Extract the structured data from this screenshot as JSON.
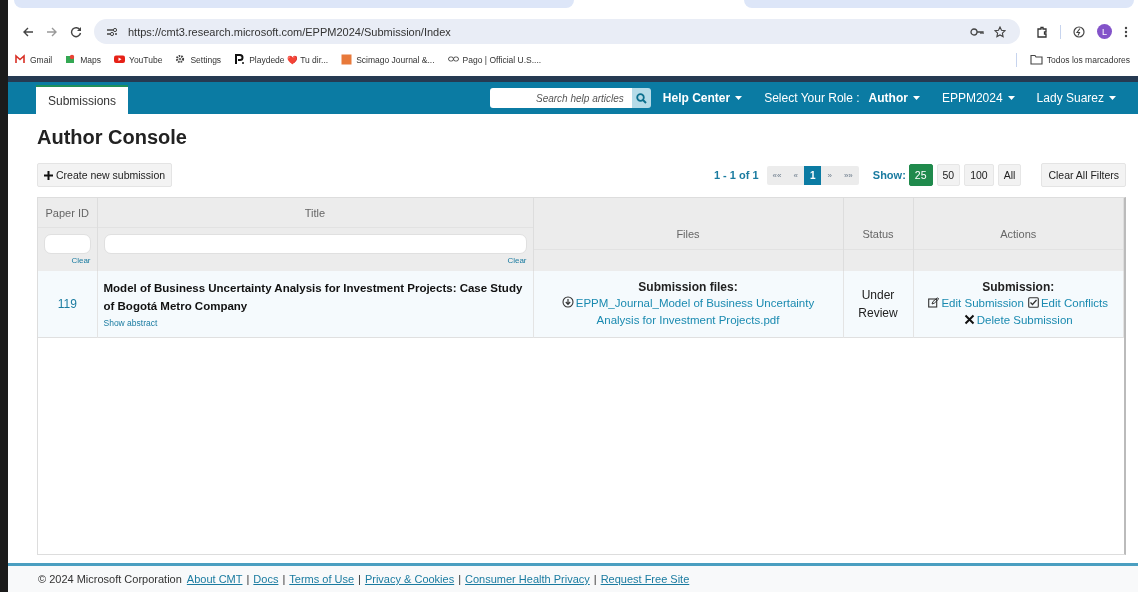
{
  "browser": {
    "url": "https://cmt3.research.microsoft.com/EPPM2024/Submission/Index",
    "profile_initial": "L",
    "bookmarks": [
      {
        "label": "Gmail",
        "kind": "mail"
      },
      {
        "label": "Maps",
        "kind": "map"
      },
      {
        "label": "YouTube",
        "kind": "video"
      },
      {
        "label": "Settings",
        "kind": "gear"
      },
      {
        "label": "Playdede ❤️ Tu dir...",
        "kind": "letter"
      },
      {
        "label": "Scimago Journal &...",
        "kind": "square"
      },
      {
        "label": "Pago | Official U.S....",
        "kind": "link"
      }
    ],
    "all_bookmarks": "Todos los marcadores"
  },
  "nav": {
    "tabs": [
      {
        "label": "Submissions",
        "selected": true
      }
    ],
    "search": {
      "placeholder": "Search help articles"
    },
    "menus": [
      {
        "label": "Help Center",
        "kind": "dropdown",
        "bold": true
      },
      {
        "label": "Select Your Role :",
        "kind": "text",
        "bold": false
      },
      {
        "label": "Author",
        "kind": "dropdown",
        "bold": true
      },
      {
        "label": "EPPM2024",
        "kind": "dropdown",
        "bold": false
      },
      {
        "label": "Lady Suarez",
        "kind": "dropdown",
        "bold": false
      }
    ]
  },
  "page": {
    "title": "Author Console",
    "create_button": "Create new submission",
    "pager": {
      "summary": "1 - 1 of 1",
      "pages": [
        {
          "label": "««",
          "selected": false
        },
        {
          "label": "«",
          "selected": false
        },
        {
          "label": "1",
          "selected": true
        },
        {
          "label": "»",
          "selected": false
        },
        {
          "label": "»»",
          "selected": false
        }
      ],
      "show_label": "Show:",
      "sizes": [
        {
          "label": "25",
          "selected": true
        },
        {
          "label": "50",
          "selected": false
        },
        {
          "label": "100",
          "selected": false
        },
        {
          "label": "All",
          "selected": false
        }
      ],
      "clear_filters": "Clear All Filters"
    }
  },
  "table": {
    "columns": [
      {
        "label": "Paper ID",
        "filter": true,
        "clear": "Clear"
      },
      {
        "label": "Title",
        "filter": true,
        "clear": "Clear"
      },
      {
        "label": "Files",
        "filter": false
      },
      {
        "label": "Status",
        "filter": false
      },
      {
        "label": "Actions",
        "filter": false
      }
    ],
    "rows": [
      {
        "paper_id": "119",
        "title": "Model of Business Uncertainty Analysis for Investment Projects: Case Study of Bogotá Metro Company",
        "show_abstract": "Show abstract",
        "files_heading": "Submission files:",
        "file": "EPPM_Journal_Model of Business Uncertainty Analysis for Investment Projects.pdf",
        "status": "Under Review",
        "actions_heading": "Submission:",
        "actions": [
          {
            "label": "Edit Submission",
            "kind": "edit"
          },
          {
            "label": "Edit Conflicts",
            "kind": "check"
          },
          {
            "label": "Delete Submission",
            "kind": "delete"
          }
        ]
      }
    ]
  },
  "footer": {
    "copyright": "© 2024 Microsoft Corporation",
    "separator": "|",
    "links": [
      "About CMT",
      "Docs",
      "Terms of Use",
      "Privacy & Cookies",
      "Consumer Health Privacy",
      "Request Free Site"
    ]
  }
}
